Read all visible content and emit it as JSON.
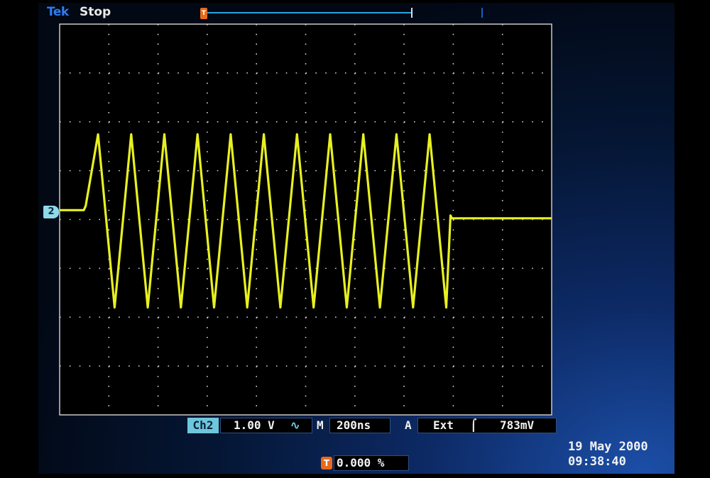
{
  "header": {
    "brand": "Tek",
    "acquisition_status": "Stop",
    "trigger_marker_glyph": "T"
  },
  "display": {
    "channel_marker": "2",
    "trace_color": "#e8f020",
    "graticule_color": "#d8d8d8"
  },
  "waveform": {
    "description_type": "triangle burst",
    "cycles": 11
  },
  "readout": {
    "channel": "Ch2",
    "scale": "1.00 V",
    "coupling_icon": "ac-coupling-icon",
    "coupling_glyph": "∿",
    "timebase_label": "M",
    "timebase": "200ns",
    "trigger_label": "A",
    "trigger_source": "Ext",
    "trigger_slope_glyph": "⌠",
    "trigger_level": "783mV",
    "trigger_position_glyph": "T",
    "trigger_position": "0.000 %"
  },
  "timestamp": {
    "date": "19 May 2000",
    "time": "09:38:40"
  }
}
